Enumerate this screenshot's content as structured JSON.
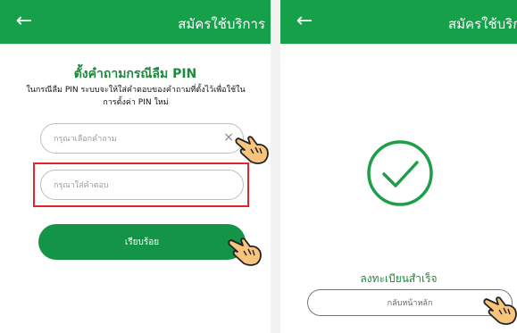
{
  "colors": {
    "brand_green": "#16a04a",
    "button_green": "#139447",
    "highlight_red": "#e0262b"
  },
  "left_screen": {
    "header": {
      "back_icon": "arrow-left-icon",
      "title": "สมัครใช้บริการ"
    },
    "form_title": "ตั้งคำถามกรณีลืม PIN",
    "form_description": "ในกรณีลืม PIN ระบบจะให้ใส่คำตอบของคำถามที่ตั้งไว้เพื่อใช้ในการตั้งค่า PIN ใหม่",
    "question_select": {
      "placeholder": "กรุณาเลือกคำถาม",
      "clear_icon": "close-icon"
    },
    "answer_input": {
      "placeholder": "กรุณาใส่คำตอบ"
    },
    "submit_button": "เรียบร้อย"
  },
  "right_screen": {
    "header": {
      "back_icon": "arrow-left-icon",
      "title": "สมัครใช้บริการ"
    },
    "success_icon": "check-circle-icon",
    "success_text": "ลงทะเบียนสำเร็จ",
    "home_button": "กลับหน้าหลัก"
  },
  "pointer_icon": "hand-pointer-icon"
}
